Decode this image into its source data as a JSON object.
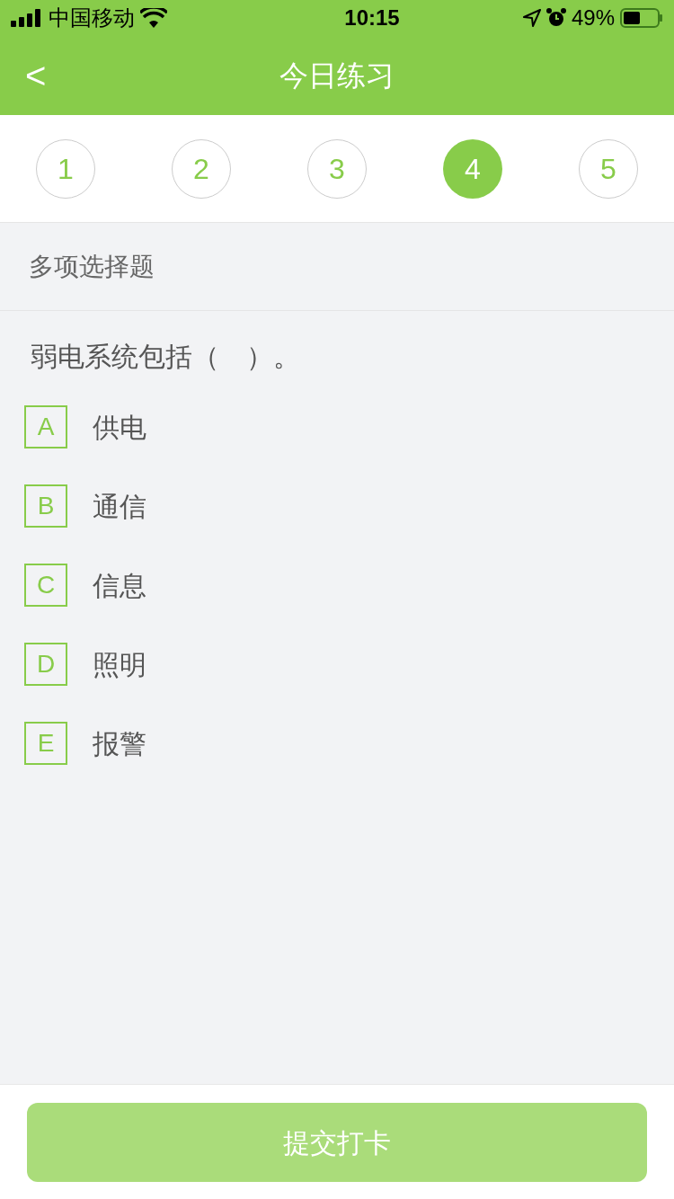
{
  "status_bar": {
    "carrier": "中国移动",
    "time": "10:15",
    "battery": "49%"
  },
  "nav": {
    "back": "<",
    "title": "今日练习"
  },
  "question_tabs": [
    {
      "label": "1",
      "selected": false
    },
    {
      "label": "2",
      "selected": false
    },
    {
      "label": "3",
      "selected": false
    },
    {
      "label": "4",
      "selected": true
    },
    {
      "label": "5",
      "selected": false
    }
  ],
  "question_type": "多项选择题",
  "question": "弱电系统包括（　）。",
  "options": [
    {
      "letter": "A",
      "text": "供电",
      "selected": false
    },
    {
      "letter": "B",
      "text": "通信",
      "selected": false
    },
    {
      "letter": "C",
      "text": "信息",
      "selected": false
    },
    {
      "letter": "D",
      "text": "照明",
      "selected": false
    },
    {
      "letter": "E",
      "text": "报警",
      "selected": false
    }
  ],
  "submit": {
    "label": "提交打卡",
    "disabled": true
  }
}
